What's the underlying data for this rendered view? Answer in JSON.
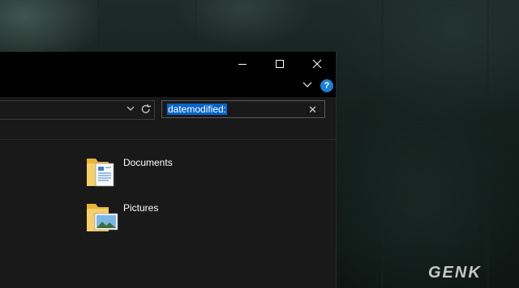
{
  "search": {
    "value": "datemodified:",
    "clear_glyph": "✕"
  },
  "address": {
    "value": ""
  },
  "items": [
    {
      "label": "Documents",
      "icon": "documents-folder-icon"
    },
    {
      "label": "Pictures",
      "icon": "pictures-folder-icon"
    }
  ],
  "watermark": "GENK",
  "colors": {
    "selection": "#0a64c8",
    "help": "#1c7fd6",
    "window_bg": "#191919",
    "titlebar": "#000000"
  }
}
